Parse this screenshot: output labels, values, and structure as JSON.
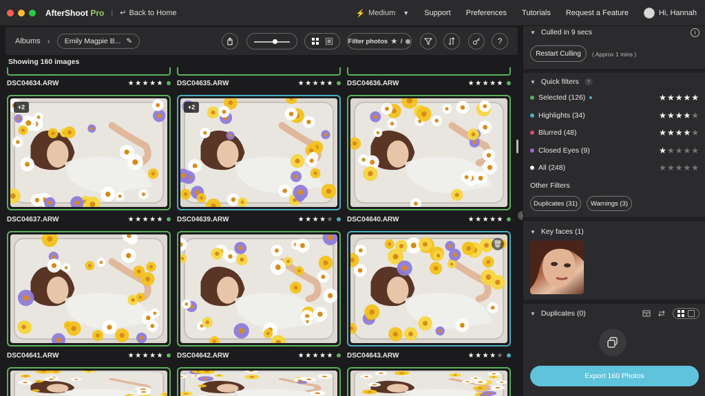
{
  "app": {
    "title": "AfterShoot",
    "title_suffix": "Pro",
    "back_label": "Back to Home"
  },
  "topnav": {
    "quality": "Medium",
    "support": "Support",
    "preferences": "Preferences",
    "tutorials": "Tutorials",
    "request_feature": "Request a Feature",
    "greeting": "Hi, Hannah"
  },
  "toolbar": {
    "albums_label": "Albums",
    "album_name": "Emily Magpie B...",
    "filter_label": "Filter photos",
    "slider_value": 0.55,
    "help_label": "?"
  },
  "grid": {
    "showing_text": "Showing 160 images",
    "top_row": [
      {
        "name": "DSC04634.ARW",
        "stars": 5,
        "status": "green"
      },
      {
        "name": "DSC04635.ARW",
        "stars": 5,
        "status": "green"
      },
      {
        "name": "DSC04636.ARW",
        "stars": 5,
        "status": "green"
      }
    ],
    "row1": [
      {
        "name": "DSC04637.ARW",
        "stars": 5,
        "status": "green",
        "border": "green",
        "badge": "+2"
      },
      {
        "name": "DSC04639.ARW",
        "stars": 4,
        "status": "blue",
        "border": "blue",
        "badge": "+2"
      },
      {
        "name": "DSC04640.ARW",
        "stars": 5,
        "status": "green",
        "border": "green",
        "badge": ""
      }
    ],
    "row2": [
      {
        "name": "DSC04641.ARW",
        "stars": 5,
        "status": "green",
        "border": "green"
      },
      {
        "name": "DSC04642.ARW",
        "stars": 5,
        "status": "green",
        "border": "green"
      },
      {
        "name": "DSC04643.ARW",
        "stars": 4,
        "status": "blue",
        "border": "blue"
      }
    ]
  },
  "panel": {
    "culled_title": "Culled in 9 secs",
    "restart_label": "Restart Culling",
    "approx_label": "( Approx 1 mins )",
    "quick_filters_title": "Quick filters",
    "quick_filters": [
      {
        "label": "Selected (126)",
        "color": "#5bb25a",
        "stars": 5,
        "extra_dot": true
      },
      {
        "label": "Highlights (34)",
        "color": "#4ab0bf",
        "stars": 4
      },
      {
        "label": "Blurred (48)",
        "color": "#d94b6a",
        "stars": 4
      },
      {
        "label": "Closed Eyes (9)",
        "color": "#9b6bd6",
        "stars": 1
      },
      {
        "label": "All (248)",
        "color": "#ffffff",
        "stars": 0
      }
    ],
    "other_filters_title": "Other Filters",
    "duplicates_btn": "Duplicates (31)",
    "warnings_btn": "Warnings (3)",
    "key_faces_title": "Key faces (1)",
    "duplicates_title": "Duplicates (0)",
    "export_label": "Export 160 Photos"
  },
  "colors": {
    "green": "#5bb25a",
    "blue": "#4ab0bf",
    "accent": "#5fc3dc"
  }
}
